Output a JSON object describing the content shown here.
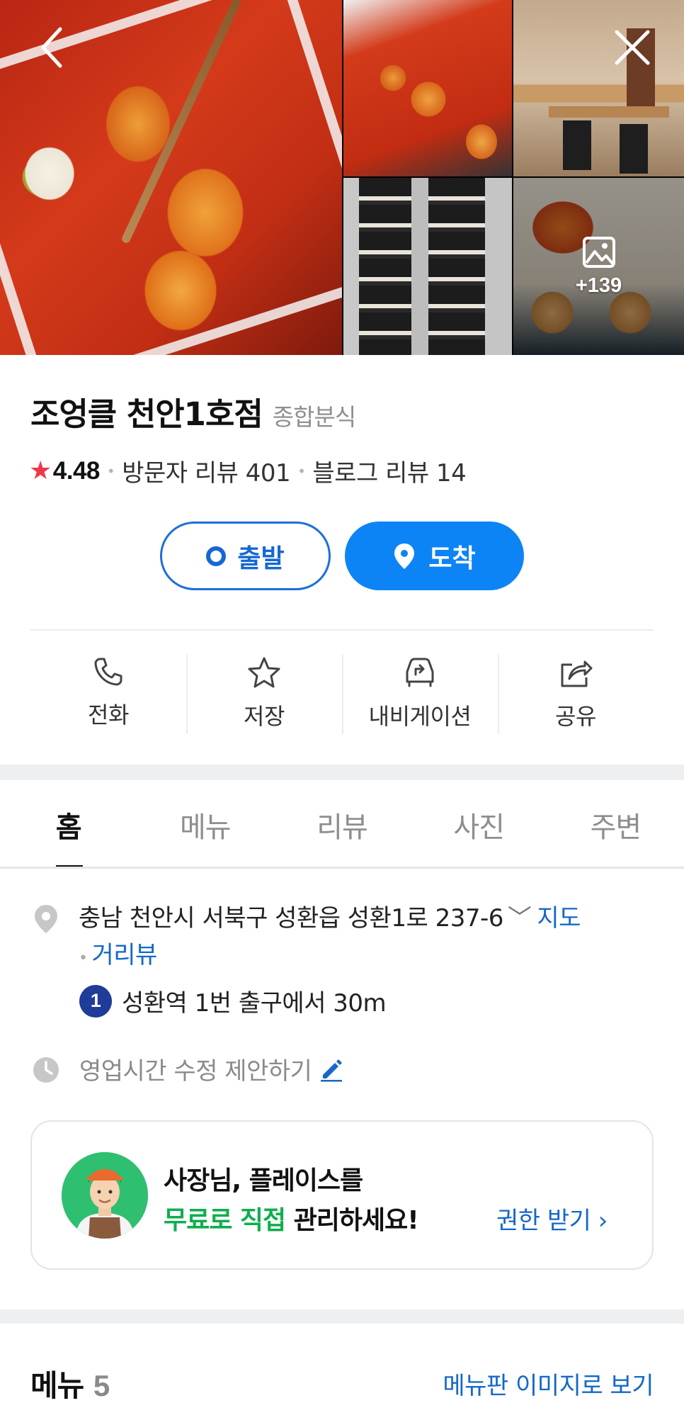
{
  "photos": {
    "more_count": "+139"
  },
  "place": {
    "name": "조엉클 천안1호점",
    "category": "종합분식",
    "rating": "4.48",
    "visitor_reviews": "방문자 리뷰 401",
    "blog_reviews": "블로그 리뷰 14"
  },
  "route": {
    "depart_label": "출발",
    "arrive_label": "도착"
  },
  "actions": [
    {
      "label": "전화",
      "icon": "phone-icon"
    },
    {
      "label": "저장",
      "icon": "star-icon"
    },
    {
      "label": "내비게이션",
      "icon": "car-navigation-icon"
    },
    {
      "label": "공유",
      "icon": "share-icon"
    }
  ],
  "tabs": [
    {
      "label": "홈",
      "active": true
    },
    {
      "label": "메뉴",
      "active": false
    },
    {
      "label": "리뷰",
      "active": false
    },
    {
      "label": "사진",
      "active": false
    },
    {
      "label": "주변",
      "active": false
    }
  ],
  "info": {
    "address": "충남 천안시 서북구 성환읍 성환1로 237-6",
    "map_link": "지도",
    "street_view_link": "거리뷰",
    "subway_line": "1",
    "subway_text": "성환역 1번 출구에서 30m",
    "hours_text": "영업시간 수정 제안하기"
  },
  "promo": {
    "line1": "사장님, 플레이스를",
    "line2_highlight": "무료로 직접",
    "line2_rest": " 관리하세요!",
    "cta": "권한 받기 ›"
  },
  "menu": {
    "title": "메뉴",
    "count": "5",
    "view_image_link": "메뉴판 이미지로 보기"
  },
  "colors": {
    "primary_blue": "#0c84f5",
    "link_blue": "#1568c8",
    "rating_star": "#f2364a",
    "promo_green": "#0fae4e",
    "subway_line1": "#1f3c99"
  }
}
